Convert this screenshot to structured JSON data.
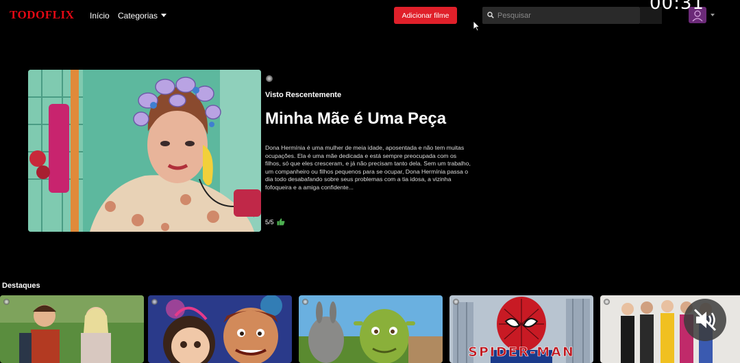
{
  "nav": {
    "logo": "TODOFLIX",
    "home_label": "Início",
    "categories_label": "Categorias",
    "add_button_label": "Adicionar filme",
    "search_placeholder": "Pesquisar"
  },
  "timer": "00:31",
  "hero": {
    "section_label": "Visto Rescentemente",
    "title": "Minha Mãe é Uma Peça",
    "description": "Dona Hermínia é uma mulher de meia idade, aposentada e não tem muitas ocupações. Ela é uma mãe dedicada e está sempre preocupada com os filhos, só que eles cresceram, e já não precisam tanto dela. Sem um trabalho, um companheiro ou filhos pequenos para se ocupar, Dona Hermínia passa o dia todo desabafando sobre seus problemas com a tia idosa, a vizinha fofoqueira e a amiga confidente...",
    "rating": "5/5"
  },
  "featured": {
    "title": "Destaques",
    "cards": [
      {
        "poster_text": ""
      },
      {
        "poster_text": ""
      },
      {
        "poster_text": ""
      },
      {
        "poster_text": "SPIDER-MAN"
      },
      {
        "poster_text": ""
      }
    ]
  },
  "icons": {
    "search": "search-icon",
    "thumbs_up": "thumbs-up-icon",
    "mute": "muted-speaker-icon",
    "avatar": "user-icon",
    "cursor": "mouse-cursor-icon"
  },
  "colors": {
    "brand": "#e50914",
    "button": "#e0202a",
    "background": "#000000"
  }
}
